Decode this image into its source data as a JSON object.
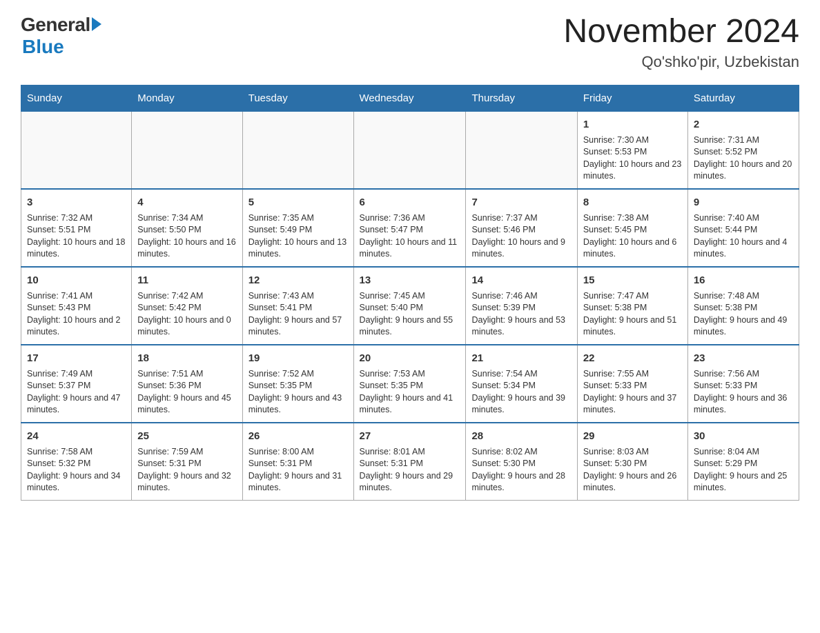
{
  "header": {
    "logo": {
      "general": "General",
      "blue": "Blue"
    },
    "title": "November 2024",
    "location": "Qo'shko'pir, Uzbekistan"
  },
  "days_of_week": [
    "Sunday",
    "Monday",
    "Tuesday",
    "Wednesday",
    "Thursday",
    "Friday",
    "Saturday"
  ],
  "weeks": [
    {
      "days": [
        {
          "number": "",
          "info": ""
        },
        {
          "number": "",
          "info": ""
        },
        {
          "number": "",
          "info": ""
        },
        {
          "number": "",
          "info": ""
        },
        {
          "number": "",
          "info": ""
        },
        {
          "number": "1",
          "info": "Sunrise: 7:30 AM\nSunset: 5:53 PM\nDaylight: 10 hours and 23 minutes."
        },
        {
          "number": "2",
          "info": "Sunrise: 7:31 AM\nSunset: 5:52 PM\nDaylight: 10 hours and 20 minutes."
        }
      ]
    },
    {
      "days": [
        {
          "number": "3",
          "info": "Sunrise: 7:32 AM\nSunset: 5:51 PM\nDaylight: 10 hours and 18 minutes."
        },
        {
          "number": "4",
          "info": "Sunrise: 7:34 AM\nSunset: 5:50 PM\nDaylight: 10 hours and 16 minutes."
        },
        {
          "number": "5",
          "info": "Sunrise: 7:35 AM\nSunset: 5:49 PM\nDaylight: 10 hours and 13 minutes."
        },
        {
          "number": "6",
          "info": "Sunrise: 7:36 AM\nSunset: 5:47 PM\nDaylight: 10 hours and 11 minutes."
        },
        {
          "number": "7",
          "info": "Sunrise: 7:37 AM\nSunset: 5:46 PM\nDaylight: 10 hours and 9 minutes."
        },
        {
          "number": "8",
          "info": "Sunrise: 7:38 AM\nSunset: 5:45 PM\nDaylight: 10 hours and 6 minutes."
        },
        {
          "number": "9",
          "info": "Sunrise: 7:40 AM\nSunset: 5:44 PM\nDaylight: 10 hours and 4 minutes."
        }
      ]
    },
    {
      "days": [
        {
          "number": "10",
          "info": "Sunrise: 7:41 AM\nSunset: 5:43 PM\nDaylight: 10 hours and 2 minutes."
        },
        {
          "number": "11",
          "info": "Sunrise: 7:42 AM\nSunset: 5:42 PM\nDaylight: 10 hours and 0 minutes."
        },
        {
          "number": "12",
          "info": "Sunrise: 7:43 AM\nSunset: 5:41 PM\nDaylight: 9 hours and 57 minutes."
        },
        {
          "number": "13",
          "info": "Sunrise: 7:45 AM\nSunset: 5:40 PM\nDaylight: 9 hours and 55 minutes."
        },
        {
          "number": "14",
          "info": "Sunrise: 7:46 AM\nSunset: 5:39 PM\nDaylight: 9 hours and 53 minutes."
        },
        {
          "number": "15",
          "info": "Sunrise: 7:47 AM\nSunset: 5:38 PM\nDaylight: 9 hours and 51 minutes."
        },
        {
          "number": "16",
          "info": "Sunrise: 7:48 AM\nSunset: 5:38 PM\nDaylight: 9 hours and 49 minutes."
        }
      ]
    },
    {
      "days": [
        {
          "number": "17",
          "info": "Sunrise: 7:49 AM\nSunset: 5:37 PM\nDaylight: 9 hours and 47 minutes."
        },
        {
          "number": "18",
          "info": "Sunrise: 7:51 AM\nSunset: 5:36 PM\nDaylight: 9 hours and 45 minutes."
        },
        {
          "number": "19",
          "info": "Sunrise: 7:52 AM\nSunset: 5:35 PM\nDaylight: 9 hours and 43 minutes."
        },
        {
          "number": "20",
          "info": "Sunrise: 7:53 AM\nSunset: 5:35 PM\nDaylight: 9 hours and 41 minutes."
        },
        {
          "number": "21",
          "info": "Sunrise: 7:54 AM\nSunset: 5:34 PM\nDaylight: 9 hours and 39 minutes."
        },
        {
          "number": "22",
          "info": "Sunrise: 7:55 AM\nSunset: 5:33 PM\nDaylight: 9 hours and 37 minutes."
        },
        {
          "number": "23",
          "info": "Sunrise: 7:56 AM\nSunset: 5:33 PM\nDaylight: 9 hours and 36 minutes."
        }
      ]
    },
    {
      "days": [
        {
          "number": "24",
          "info": "Sunrise: 7:58 AM\nSunset: 5:32 PM\nDaylight: 9 hours and 34 minutes."
        },
        {
          "number": "25",
          "info": "Sunrise: 7:59 AM\nSunset: 5:31 PM\nDaylight: 9 hours and 32 minutes."
        },
        {
          "number": "26",
          "info": "Sunrise: 8:00 AM\nSunset: 5:31 PM\nDaylight: 9 hours and 31 minutes."
        },
        {
          "number": "27",
          "info": "Sunrise: 8:01 AM\nSunset: 5:31 PM\nDaylight: 9 hours and 29 minutes."
        },
        {
          "number": "28",
          "info": "Sunrise: 8:02 AM\nSunset: 5:30 PM\nDaylight: 9 hours and 28 minutes."
        },
        {
          "number": "29",
          "info": "Sunrise: 8:03 AM\nSunset: 5:30 PM\nDaylight: 9 hours and 26 minutes."
        },
        {
          "number": "30",
          "info": "Sunrise: 8:04 AM\nSunset: 5:29 PM\nDaylight: 9 hours and 25 minutes."
        }
      ]
    }
  ]
}
